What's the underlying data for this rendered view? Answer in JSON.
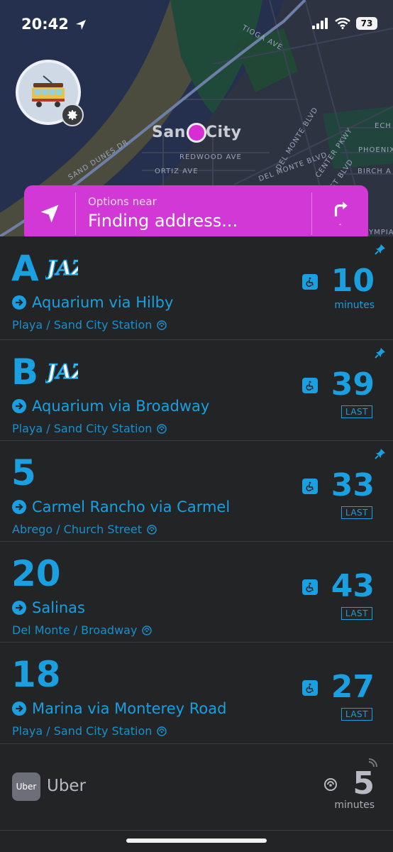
{
  "status_bar": {
    "time": "20:42",
    "battery": "73"
  },
  "map": {
    "city_label_left": "San",
    "city_label_right": "City",
    "streets": [
      "TIOGA AVE",
      "REDWOOD AVE",
      "ORTIZ AVE",
      "DEL MONTE BLVD",
      "DEL MONTE BLVD",
      "ECH",
      "PHOENIX",
      "BIRCH A",
      "SAND DUNES DR",
      "CENTER PKWY",
      "ST BLVD",
      "YMPIA"
    ]
  },
  "banner": {
    "options_label": "Options near",
    "address_text": "Finding address...",
    "dir_sub": "-",
    "color": "#d238d6"
  },
  "routes": [
    {
      "name": "A",
      "brand": "JAZZ",
      "destination": "Aquarium via Hilby",
      "stop": "Playa / Sand City Station",
      "minutes": "10",
      "sub": "minutes",
      "pinned": true,
      "last": false
    },
    {
      "name": "B",
      "brand": "JAZZ",
      "destination": "Aquarium via Broadway",
      "stop": "Playa / Sand City Station",
      "minutes": "39",
      "sub": "LAST",
      "pinned": true,
      "last": true
    },
    {
      "name": "5",
      "brand": "",
      "destination": "Carmel Rancho via Carmel",
      "stop": "Abrego / Church Street",
      "minutes": "33",
      "sub": "LAST",
      "pinned": true,
      "last": true
    },
    {
      "name": "20",
      "brand": "",
      "destination": "Salinas",
      "stop": "Del Monte / Broadway",
      "minutes": "43",
      "sub": "LAST",
      "pinned": false,
      "last": true
    },
    {
      "name": "18",
      "brand": "",
      "destination": "Marina via Monterey Road",
      "stop": "Playa / Sand City Station",
      "minutes": "27",
      "sub": "LAST",
      "pinned": false,
      "last": true
    }
  ],
  "uber": {
    "logo_text": "Uber",
    "name": "Uber",
    "minutes": "5",
    "sub": "minutes"
  },
  "colors": {
    "accent": "#1a9fe0",
    "background": "#232426",
    "map_bg": "#26304f"
  }
}
